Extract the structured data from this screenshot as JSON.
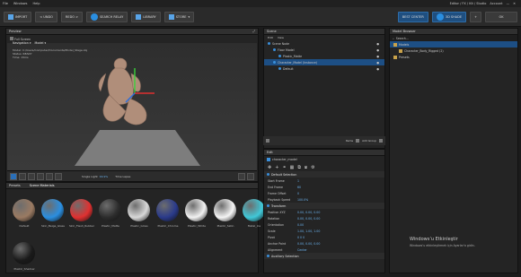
{
  "menu": {
    "items": [
      "File",
      "Windows",
      "Help"
    ],
    "right_info": "Editor / FX / Kit / Studio",
    "right_user": "Account"
  },
  "toolbar": {
    "import_label": "IMPORT",
    "undo_label": "< UNDO",
    "redo_label": "REDO >",
    "search_label": "SEARCH RELAY",
    "library_label": "LIBRARY",
    "store_label": "STORE",
    "best_label": "BEST CENTER",
    "shade3d_label": "3D SHADE",
    "plus_label": "+",
    "settings_label": "OK"
  },
  "preview": {
    "title": "Preview",
    "fullscreen_label": "Full Screen",
    "navigation_label": "Navigation",
    "mode_label": "Model",
    "path_line": "Model: C:/Users/Computer/Documents/Model_Stage.obj",
    "status_line": "Status: READY",
    "time_line": "Time: 15ms",
    "view_label": "Single Light",
    "view_value": "99.9%",
    "spin_label": "Time Lapse"
  },
  "materials": {
    "tab_presets": "Presets",
    "tab_scene": "Scene Materials",
    "items": [
      {
        "name": "Default",
        "color": "#9a7a62"
      },
      {
        "name": "Skin_Beige_Glass",
        "color": "#2a8ee0"
      },
      {
        "name": "Skin_Flesh_Rubber",
        "color": "#e03030"
      },
      {
        "name": "Plastic_Matte",
        "color": "#2c2c2c"
      },
      {
        "name": "Plastic_Gloss",
        "color": "#d8d8d8"
      },
      {
        "name": "Plastic_Chrome",
        "color": "#2a3a8a"
      },
      {
        "name": "Plastic_White",
        "color": "#f2f2f2"
      },
      {
        "name": "Plastic_Satin",
        "color": "#f5f5f5"
      },
      {
        "name": "Metal_Ice",
        "color": "#40c8d8"
      },
      {
        "name": "Default",
        "color": "#e6e6e6"
      },
      {
        "name": "Plastic_Shadow",
        "color": "#1a1a1a"
      }
    ]
  },
  "scene": {
    "title": "Scene",
    "tabs": [
      "Edit",
      "View"
    ],
    "items": [
      {
        "label": "Scene Node",
        "depth": 0,
        "selected": false
      },
      {
        "label": "Floor Model",
        "depth": 1,
        "selected": false
      },
      {
        "label": "Plastic_Matte",
        "depth": 2,
        "selected": false
      },
      {
        "label": "Character_Model (Instance)",
        "depth": 1,
        "selected": true
      },
      {
        "label": "Default",
        "depth": 2,
        "selected": false
      }
    ],
    "footer_a": "Items",
    "footer_b": "Add Group"
  },
  "edit": {
    "title": "Edit",
    "object_name": "character_model",
    "section_material": "Default Selection",
    "section_transform": "Transform",
    "section_auxiliary": "Auxiliary Selection",
    "props": [
      {
        "k": "Start Frame",
        "v": "1"
      },
      {
        "k": "End Frame",
        "v": "60"
      },
      {
        "k": "Frame Offset",
        "v": "0"
      },
      {
        "k": "Playback Speed",
        "v": "100.0%"
      }
    ],
    "transform": [
      {
        "k": "Position XYZ",
        "v": "0.00, 0.00, 0.00"
      },
      {
        "k": "Rotation",
        "v": "0.00, 0.00, 0.00"
      },
      {
        "k": "Orientation",
        "v": "0.00"
      },
      {
        "k": "Scale",
        "v": "1.00, 1.00, 1.00"
      },
      {
        "k": "Pivot",
        "v": "0 0 0"
      },
      {
        "k": "Anchor Point",
        "v": "0.00, 0.00, 0.00"
      },
      {
        "k": "Alignment",
        "v": "Center"
      }
    ]
  },
  "browser": {
    "title": "Model Browser",
    "search_placeholder": "Search...",
    "items": [
      {
        "label": "Models",
        "selected": true
      },
      {
        "label": "Character_Body_Rigged (2)",
        "selected": false
      },
      {
        "label": "Presets",
        "selected": false
      }
    ]
  },
  "watermark": {
    "line1": "Windows’u Etkinleştir",
    "line2": "Windows’u etkinleştirmek için Ayarlar’a gidin."
  },
  "colors": {
    "accent": "#2a8ee0",
    "selection": "#1d4f85",
    "panel": "#242424"
  }
}
